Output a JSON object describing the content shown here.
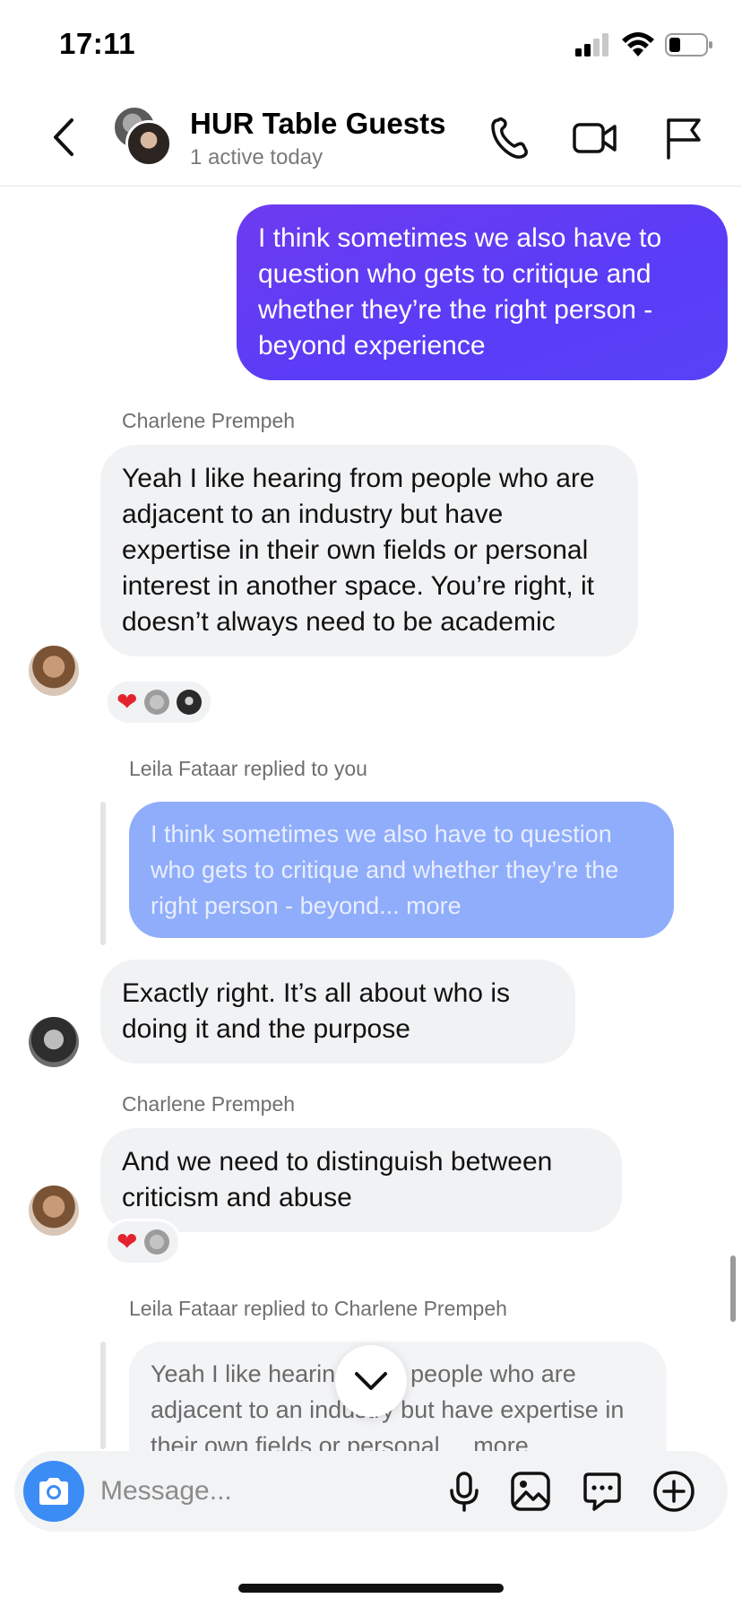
{
  "status": {
    "time": "17:11"
  },
  "header": {
    "title": "HUR Table Guests",
    "subtitle": "1 active today"
  },
  "messages": [
    {
      "type": "outgoing",
      "text": "I think sometimes we also have to question who gets to critique and whether they’re the right person - beyond experience"
    },
    {
      "type": "incoming",
      "sender": "Charlene Prempeh",
      "text": "Yeah I like hearing from people who are adjacent to an industry but have expertise in their own fields or personal interest in another space. You’re right, it doesn’t always need to be academic",
      "reactions": [
        "heart",
        "avatar-grey",
        "avatar-dark"
      ]
    },
    {
      "type": "reply",
      "reply_label": "Leila Fataar replied to you",
      "quoted_text": "I think sometimes we also have to question who gets to critique and whether they’re the right person - beyond...",
      "quoted_more": " more",
      "text": "Exactly right. It’s all about who is doing it and the purpose"
    },
    {
      "type": "incoming",
      "sender": "Charlene Prempeh",
      "text": "And we need to distinguish between criticism and abuse",
      "reactions": [
        "heart",
        "avatar-grey"
      ]
    },
    {
      "type": "reply",
      "reply_label": "Leila Fataar replied to Charlene Prempeh",
      "quoted_text": "Yeah I like hearing from people who are adjacent to an industry but have expertise in their own fields or personal ...",
      "quoted_more": " more"
    }
  ],
  "composer": {
    "placeholder": "Message..."
  },
  "icons": {
    "back": "chevron-left-icon",
    "call": "phone-icon",
    "video": "video-camera-icon",
    "report": "flag-icon",
    "camera": "camera-icon",
    "mic": "microphone-icon",
    "gallery": "image-icon",
    "sticker": "chat-bubble-icon",
    "more": "plus-circle-icon"
  },
  "colors": {
    "outgoing_bubble": "#5b3cf7",
    "quote_bubble": "#8fadfb",
    "incoming_bubble": "#f1f2f4",
    "camera_button": "#3b8cf5",
    "heart": "#e3232e"
  }
}
